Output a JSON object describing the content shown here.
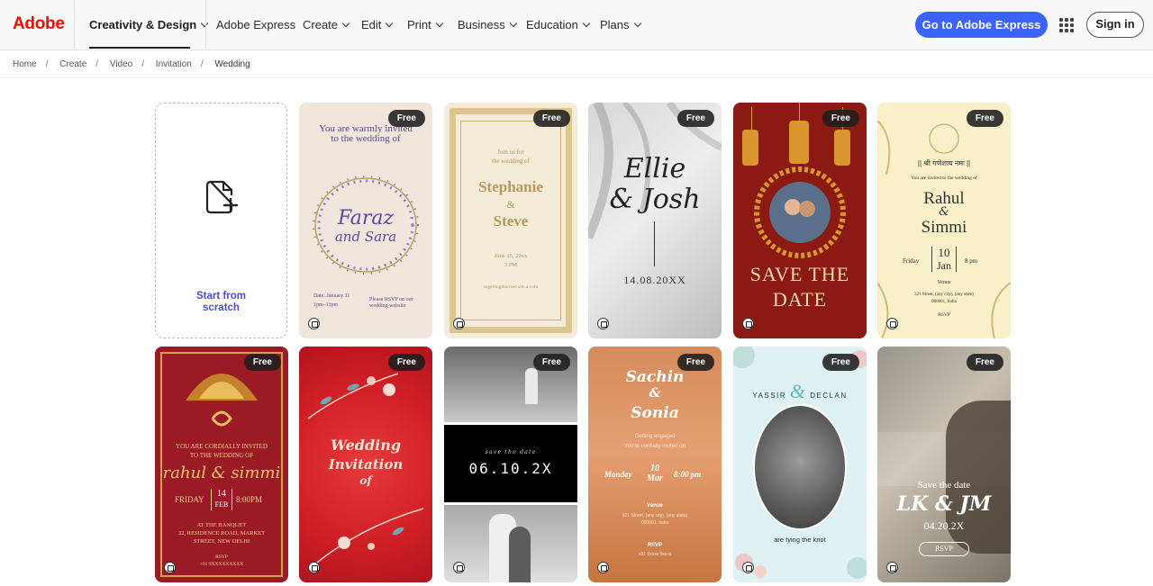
{
  "header": {
    "logo": "Adobe",
    "nav_main": "Creativity & Design",
    "nav": [
      "Adobe Express",
      "Create",
      "Edit",
      "Print",
      "Business",
      "Education",
      "Plans"
    ],
    "cta": "Go to Adobe Express",
    "signin": "Sign in"
  },
  "breadcrumb": [
    "Home",
    "Create",
    "Video",
    "Invitation",
    "Wedding"
  ],
  "scratch": {
    "label_line1": "Start from",
    "label_line2": "scratch"
  },
  "badge": "Free",
  "cards": {
    "c1": {
      "l1": "You are warmly invited",
      "l2": "to the wedding of",
      "n1": "Faraz",
      "n2": "and Sara",
      "d1": "Date: January 11",
      "d2": "1pm–11pm",
      "r1": "Please RSVP on our",
      "r2": "wedding website"
    },
    "c2": {
      "l1": "Join us for",
      "l2": "the wedding of",
      "n1": "Stephanie",
      "amp": "&",
      "n2": "Steve",
      "d1": "June 15, 20xx",
      "d2": "3 PM",
      "site": "segettingmarried.site.a.com"
    },
    "c3": {
      "n1": "Ellie",
      "n2": "& Josh",
      "date": "14.08.20XX"
    },
    "c4": {
      "l1": "SAVE THE",
      "l2": "DATE"
    },
    "c5": {
      "top": "|| श्री गणेशाय नमः ||",
      "inv": "You are invited to the wedding of",
      "n1": "Rahul",
      "amp": "&",
      "n2": "Simmi",
      "day": "Friday",
      "num": "10",
      "mon": "Jan",
      "time": "8 pm",
      "venue": "Venue",
      "a1": "321 Street, (any city), (any state)",
      "a2": "000001, India",
      "rsvp": "RSVP"
    },
    "c6": {
      "l1": "YOU ARE CORDIALLY INVITED",
      "l2": "TO THE WEDDING OF",
      "names": "rahul & simmi",
      "day": "FRIDAY",
      "num": "14",
      "mon": "FEB",
      "time": "8:00PM",
      "v1": "AT THE BANQUET",
      "v2": "32, RESIDENCE ROAD, MARKET",
      "v3": "STREET, NEW DELHI",
      "rsvp": "RSVP",
      "phone": "+91 9XXXXXXXXX"
    },
    "c7": {
      "l1": "Wedding",
      "l2": "Invitation",
      "l3": "of"
    },
    "c8": {
      "sub": "save the date",
      "date": "06.10.2X"
    },
    "c9": {
      "n1": "Sachin",
      "amp": "&",
      "n2": "Sonia",
      "e1": "Getting engaged",
      "e2": "You're cordially invited on",
      "day": "Monday",
      "num": "10",
      "mon": "Mar",
      "time": "8:00 pm",
      "venue": "Venue",
      "a1": "321 Street, (any city), (any state)",
      "a2": "000001, India",
      "rsvp": "RSVP",
      "phone": "+91 0xxxx 9xxxx"
    },
    "c10": {
      "n1": "YASSIR",
      "amp": "&",
      "n2": "DECLAN",
      "bottom": "are tying the knot"
    },
    "c11": {
      "l1": "Save the date",
      "names": "LK & JM",
      "date": "04.20.2X",
      "rsvp": "RSVP"
    }
  }
}
